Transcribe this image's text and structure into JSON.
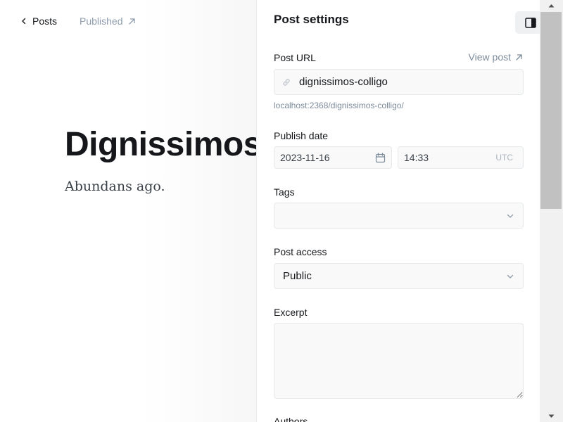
{
  "editor": {
    "back_label": "Posts",
    "status_label": "Published",
    "title": "Dignissimos",
    "body": "Abundans ago."
  },
  "settings": {
    "title": "Post settings",
    "post_url": {
      "label": "Post URL",
      "view_post": "View post",
      "value": "dignissimos-colligo",
      "hint": "localhost:2368/dignissimos-colligo/"
    },
    "publish_date": {
      "label": "Publish date",
      "date": "2023-11-16",
      "time": "14:33",
      "timezone": "UTC"
    },
    "tags": {
      "label": "Tags",
      "value": ""
    },
    "post_access": {
      "label": "Post access",
      "value": "Public"
    },
    "excerpt": {
      "label": "Excerpt",
      "value": ""
    },
    "authors": {
      "label": "Authors"
    }
  },
  "icons": {
    "back": "chevron-left-icon",
    "status": "arrow-up-right-icon",
    "view_post": "arrow-up-right-icon",
    "url": "link-icon",
    "date": "calendar-icon",
    "select": "chevron-down-icon",
    "toggle": "sidebar-toggle-icon"
  },
  "colors": {
    "accent_text": "#15171a",
    "muted_text": "#7c8b9a",
    "field_background": "#f9f9fa",
    "field_border": "#e6e9eb"
  }
}
